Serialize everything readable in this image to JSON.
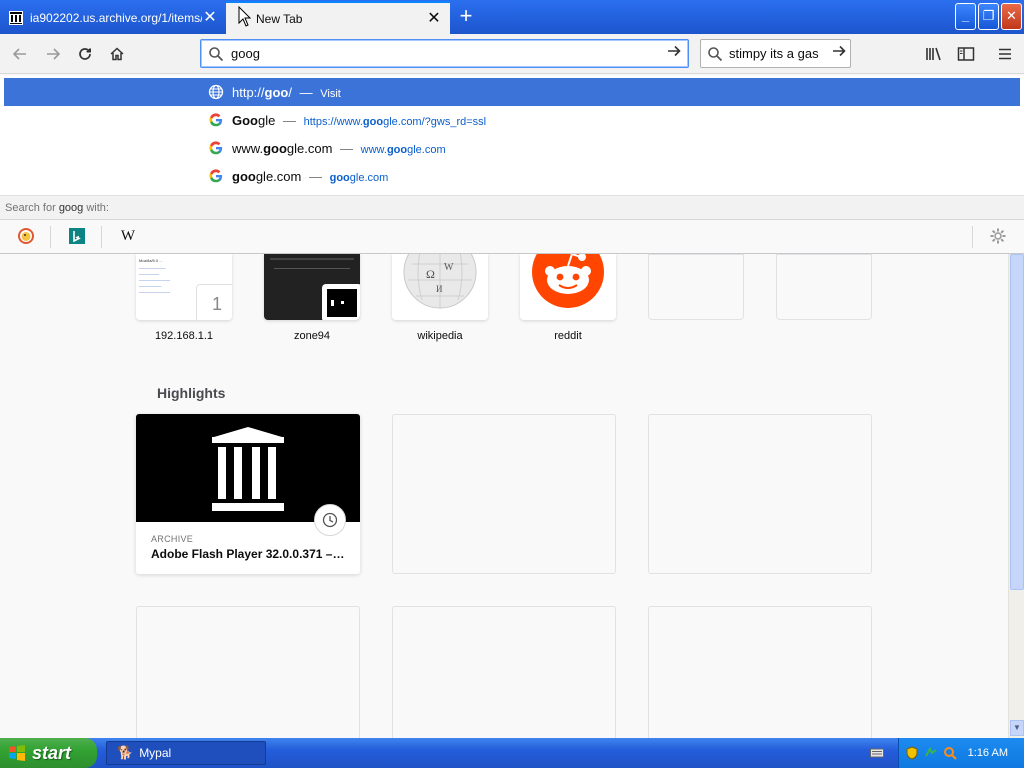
{
  "tabs": [
    {
      "title": "ia902202.us.archive.org/1/items/",
      "active": false
    },
    {
      "title": "New Tab",
      "active": true
    }
  ],
  "urlbar": {
    "value": "goog"
  },
  "searchbar": {
    "value": "stimpy its a gas"
  },
  "suggestions": [
    {
      "prefix": "http://",
      "bold": "goo",
      "rest": "/",
      "action": "Visit",
      "url_pre": "",
      "url_bold": "",
      "url_post": "",
      "selected": true,
      "icon": "globe-icon"
    },
    {
      "prefix": "",
      "bold": "Goo",
      "rest": "gle",
      "action": "",
      "url_pre": "https://www.",
      "url_bold": "goo",
      "url_post": "gle.com/?gws_rd=ssl",
      "selected": false,
      "icon": "google-icon"
    },
    {
      "prefix": "www.",
      "bold": "goo",
      "rest": "gle.com",
      "action": "",
      "url_pre": "www.",
      "url_bold": "goo",
      "url_post": "gle.com",
      "selected": false,
      "icon": "google-icon"
    },
    {
      "prefix": "",
      "bold": "goo",
      "rest": "gle.com",
      "action": "",
      "url_pre": "",
      "url_bold": "goo",
      "url_post": "gle.com",
      "selected": false,
      "icon": "google-icon"
    }
  ],
  "search_for": {
    "prefix": "Search for ",
    "term": "goog",
    "suffix": " with:"
  },
  "engines": [
    "duckduckgo-icon",
    "bing-icon",
    "wikipedia-icon"
  ],
  "top_sites": [
    {
      "label": "192.168.1.1",
      "badge": "1"
    },
    {
      "label": "zone94"
    },
    {
      "label": "wikipedia"
    },
    {
      "label": "reddit"
    },
    {
      "label": ""
    },
    {
      "label": ""
    }
  ],
  "highlights": {
    "title": "Highlights",
    "cards": [
      {
        "source": "ARCHIVE",
        "title": "Adobe Flash Player 32.0.0.371 – I..."
      }
    ]
  },
  "taskbar": {
    "start_label": "start",
    "item_label": "Mypal",
    "clock": "1:16 AM"
  },
  "colors": {
    "accent": "#0a84ff",
    "selected": "#3c73d9",
    "reddit": "#ff4500"
  }
}
